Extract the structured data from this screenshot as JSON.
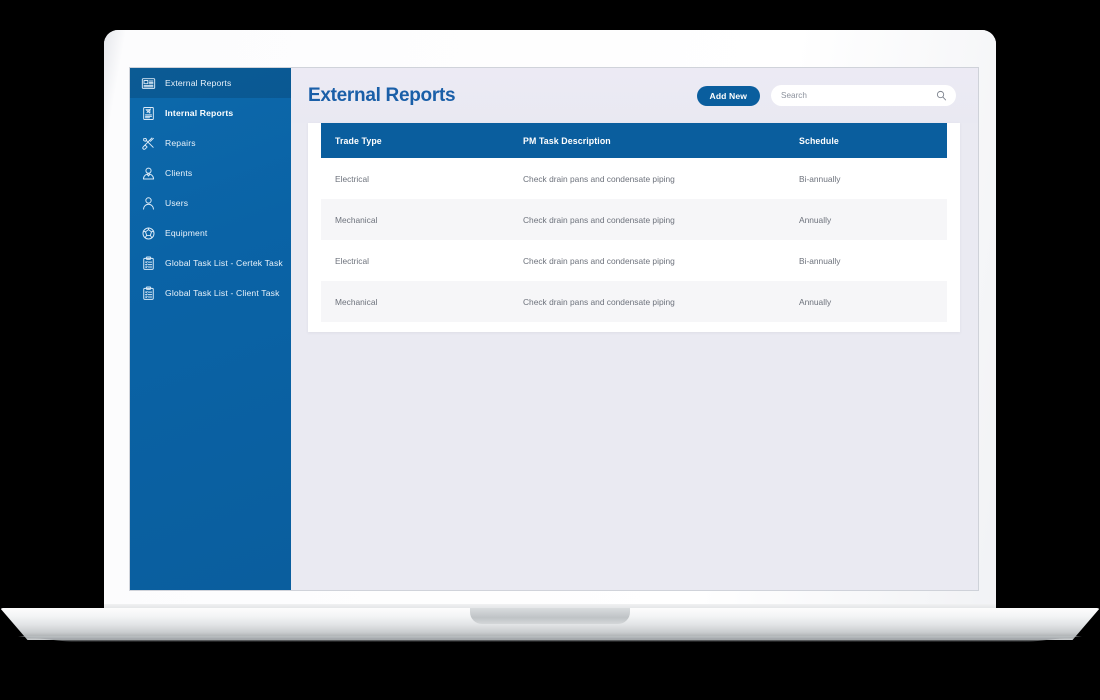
{
  "app": {
    "accent_blue": "#0a5e9e",
    "title_blue": "#1a5fa8",
    "content_bg": "#eaeaf2",
    "row_alt_bg": "#f6f6f8"
  },
  "sidebar": {
    "items": [
      {
        "label": "External Reports",
        "icon": "newspaper-icon",
        "active": true,
        "bold": false
      },
      {
        "label": "Internal Reports",
        "icon": "document-report-icon",
        "active": false,
        "bold": true
      },
      {
        "label": "Repairs",
        "icon": "wrench-screwdriver-icon",
        "active": false,
        "bold": false
      },
      {
        "label": "Clients",
        "icon": "person-tie-icon",
        "active": false,
        "bold": false
      },
      {
        "label": "Users",
        "icon": "person-icon",
        "active": false,
        "bold": false
      },
      {
        "label": "Equipment",
        "icon": "gear-ball-icon",
        "active": false,
        "bold": false
      },
      {
        "label": "Global Task List - Certek Task",
        "icon": "clipboard-list-icon",
        "active": false,
        "bold": false
      },
      {
        "label": "Global Task List - Client Task",
        "icon": "clipboard-list-icon",
        "active": false,
        "bold": false
      }
    ]
  },
  "header": {
    "title": "External Reports",
    "add_new_label": "Add New",
    "search_placeholder": "Search",
    "search_value": "",
    "search_icon": "magnifier-icon"
  },
  "table": {
    "columns": [
      "Trade Type",
      "PM Task Description",
      "Schedule"
    ],
    "rows": [
      {
        "trade_type": "Electrical",
        "task": "Check drain pans and condensate piping",
        "schedule": "Bi-annually"
      },
      {
        "trade_type": "Mechanical",
        "task": "Check drain pans and condensate piping",
        "schedule": "Annually"
      },
      {
        "trade_type": "Electrical",
        "task": "Check drain pans and condensate piping",
        "schedule": "Bi-annually"
      },
      {
        "trade_type": "Mechanical",
        "task": "Check drain pans and condensate piping",
        "schedule": "Annually"
      }
    ]
  }
}
